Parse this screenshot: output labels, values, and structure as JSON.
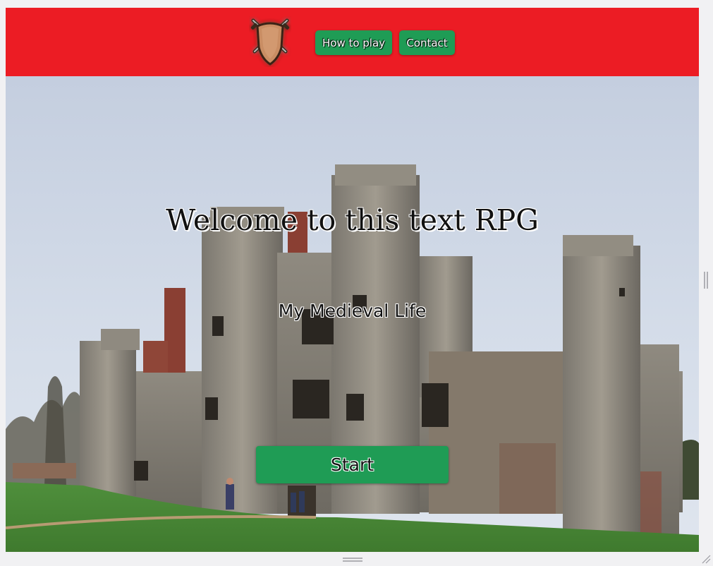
{
  "header": {
    "logo_icon": "shield-crossed-swords-icon",
    "background_color": "#ec1c24",
    "nav": [
      {
        "label": "How to play"
      },
      {
        "label": "Contact"
      }
    ],
    "button_color": "#1f9c55"
  },
  "hero": {
    "background_image": "stone-castle-ruins-photo",
    "title": "Welcome to this text RPG",
    "subtitle": "My Medieval Life",
    "start_label": "Start"
  }
}
